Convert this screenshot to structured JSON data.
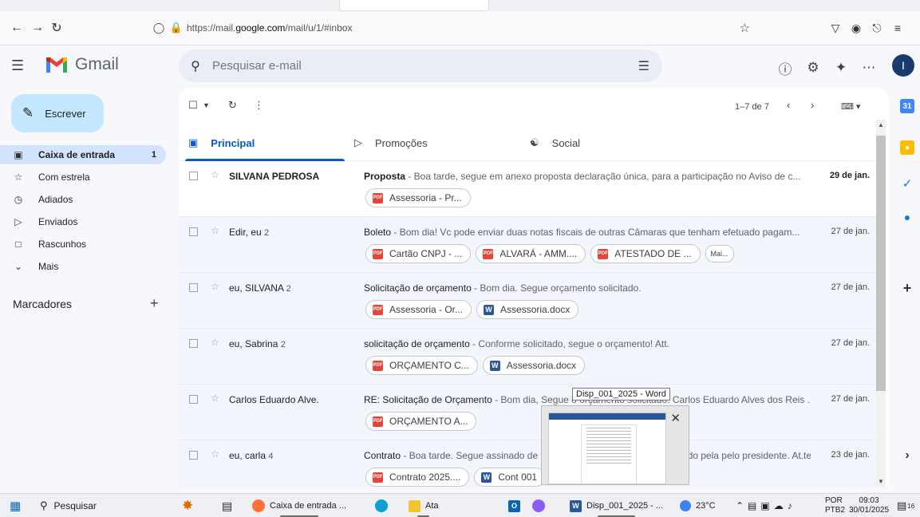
{
  "browser": {
    "url_prefix": "https://mail.",
    "url_domain": "google.com",
    "url_path": "/mail/u/1/#inbox"
  },
  "gmail": {
    "logo_text": "Gmail",
    "search_placeholder": "Pesquisar e-mail",
    "avatar_letter": "I"
  },
  "nav": {
    "compose": "Escrever",
    "items": [
      {
        "label": "Caixa de entrada",
        "count": "1"
      },
      {
        "label": "Com estrela"
      },
      {
        "label": "Adiados"
      },
      {
        "label": "Enviados"
      },
      {
        "label": "Rascunhos"
      },
      {
        "label": "Mais"
      }
    ],
    "labels_title": "Marcadores",
    "labels_add": "+"
  },
  "toolbar": {
    "pager": "1–7 de 7"
  },
  "tabs": [
    {
      "label": "Principal"
    },
    {
      "label": "Promoções"
    },
    {
      "label": "Social"
    }
  ],
  "emails": [
    {
      "sender": "SILVANA PEDROSA",
      "count": "",
      "subject": "Proposta",
      "snippet": " - Boa tarde, segue em anexo proposta declaração única, para a participação no Aviso de c...",
      "date": "29 de jan.",
      "attachments": [
        {
          "type": "pdf",
          "name": "Assessoria - Pr..."
        }
      ]
    },
    {
      "sender": "Edir, eu",
      "count": "2",
      "subject": "Boleto",
      "snippet": " - Bom dia! Vc pode enviar duas notas fiscais de outras Câmaras que tenham efetuado pagam...",
      "date": "27 de jan.",
      "attachments": [
        {
          "type": "pdf",
          "name": "Cartão CNPJ - ..."
        },
        {
          "type": "pdf",
          "name": "ALVARÁ - AMM...."
        },
        {
          "type": "pdf",
          "name": "ATESTADO DE ..."
        }
      ],
      "more": "Mai..."
    },
    {
      "sender": "eu, SILVANA",
      "count": "2",
      "subject": "Solicitação de orçamento",
      "snippet": " - Bom dia. Segue orçamento solicitado.",
      "date": "27 de jan.",
      "attachments": [
        {
          "type": "pdf",
          "name": "Assessoria - Or..."
        },
        {
          "type": "word",
          "name": "Assessoria.docx"
        }
      ]
    },
    {
      "sender": "eu, Sabrina",
      "count": "2",
      "subject": "solicitação de orçamento",
      "snippet": " - Conforme solicitado, segue o orçamento! Att.",
      "date": "27 de jan.",
      "attachments": [
        {
          "type": "pdf",
          "name": "ORÇAMENTO C..."
        },
        {
          "type": "word",
          "name": "Assessoria.docx"
        }
      ]
    },
    {
      "sender": "Carlos Eduardo Alve.",
      "count": "",
      "subject": "RE: Solicitação de Orçamento",
      "snippet": " - Bom dia, Segue o orçamento solicitado. Carlos Eduardo Alves dos Reis ...",
      "date": "27 de jan.",
      "attachments": [
        {
          "type": "pdf",
          "name": "ORÇAMENTO A..."
        }
      ]
    },
    {
      "sender": "eu, carla",
      "count": "4",
      "subject": "Contrato",
      "snippet": " - Boa tarde. Segue assinado de forma eletrônica o contrato, assinado pela pelo presidente. At.te",
      "date": "23 de jan.",
      "attachments": [
        {
          "type": "pdf",
          "name": "Contrato 2025...."
        },
        {
          "type": "word",
          "name": "Cont 001"
        }
      ]
    }
  ],
  "preview": {
    "tooltip": "Disp_001_2025 - Word"
  },
  "taskbar": {
    "search": "Pesquisar",
    "firefox": "Caixa de entrada ...",
    "folder": "Ata",
    "word": "Disp_001_2025 - ...",
    "weather": "23°C",
    "lang1": "POR",
    "lang2": "PTB2",
    "time": "09:03",
    "date": "30/01/2025",
    "notif": "16"
  },
  "colors": {
    "accent": "#0b57d0",
    "compose": "#c2e7ff",
    "nav_active": "#d3e3fd",
    "pdf": "#ea4335",
    "word": "#2b579a"
  }
}
